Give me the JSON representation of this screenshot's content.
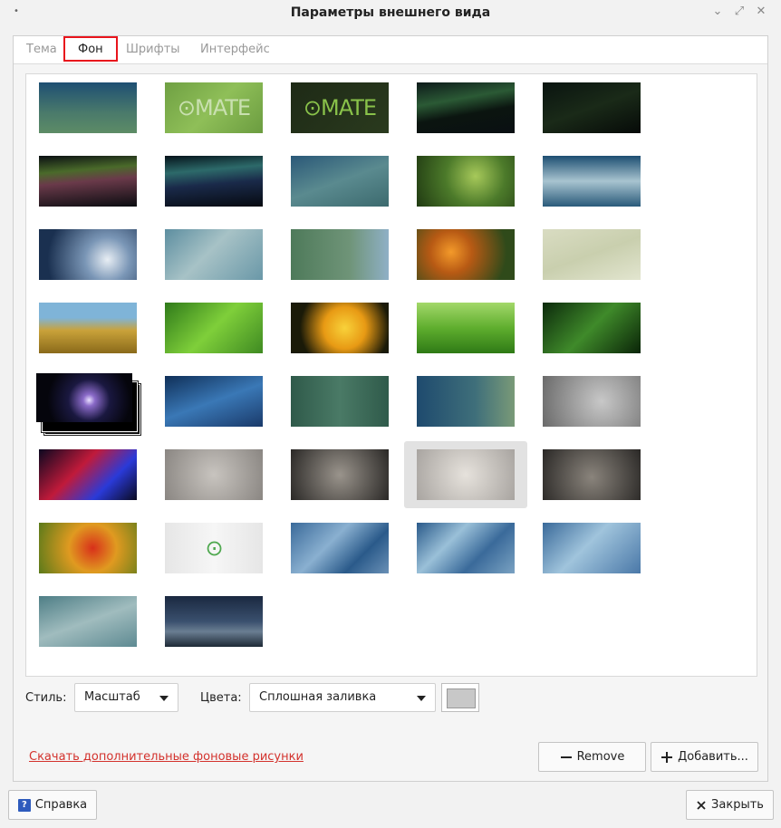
{
  "window": {
    "title": "Параметры внешнего вида",
    "menu_glyph": "•",
    "ctl_shade": "⌄",
    "ctl_maximize": "⤢",
    "ctl_close": "✕"
  },
  "tabs": [
    {
      "label": "Тема",
      "active": false
    },
    {
      "label": "Фон",
      "active": true
    },
    {
      "label": "Шрифты",
      "active": false
    },
    {
      "label": "Интерфейс",
      "active": false
    }
  ],
  "thumbnails": [
    {
      "name": "plain-blue-green",
      "bg": "linear-gradient(180deg,#1e4f73 0%,#4a7a6b 60%,#5d8c66 100%)",
      "text": ""
    },
    {
      "name": "mate-logo-green",
      "bg": "linear-gradient(135deg,#6fa043 0%,#8fbf58 50%,#6b9c40 100%)",
      "text": "⊙MATE",
      "text_color": "#c9e0b0"
    },
    {
      "name": "mate-logo-dark",
      "bg": "linear-gradient(135deg,#1e2a16 0%,#2a3a1e 100%)",
      "text": "⊙MATE",
      "text_color": "#89c24a"
    },
    {
      "name": "aurora-dark",
      "bg": "linear-gradient(170deg,#0d1a1a 0%,#2b5a35 35%,#0b1510 60%,#0a0f12 100%)",
      "text": ""
    },
    {
      "name": "dark-teal",
      "bg": "linear-gradient(160deg,#0a1410 0%,#1a2a18 50%,#060a08 100%)",
      "text": ""
    },
    {
      "name": "aurora-colorful",
      "bg": "linear-gradient(175deg,#0a0e12 0%,#4a6a2a 30%,#6a3a4a 50%,#0a0c10 100%)",
      "text": ""
    },
    {
      "name": "aurora-cyan",
      "bg": "linear-gradient(175deg,#05121a 0%,#2d6a6a 30%,#1a2a4a 55%,#060a10 100%)",
      "text": ""
    },
    {
      "name": "blue-curve",
      "bg": "linear-gradient(160deg,#2a5878 0%,#5a8a8f 50%,#3c6a6e 100%)",
      "text": ""
    },
    {
      "name": "ladybug-grass",
      "bg": "radial-gradient(circle at 60% 40%,#a7c95a 0%,#4c7a2a 45%,#203a12 100%)",
      "text": ""
    },
    {
      "name": "blue-wave",
      "bg": "linear-gradient(180deg,#1d4e72 0%,#a8c4d0 50%,#2a5a7a 100%)",
      "text": ""
    },
    {
      "name": "water-drop",
      "bg": "radial-gradient(circle at 70% 60%,#e8eef4 0%,#7a96b6 30%,#1a3050 80%)",
      "text": ""
    },
    {
      "name": "pale-curves",
      "bg": "linear-gradient(135deg,#5d8ea0 0%,#a7c2c6 45%,#6a98a8 100%)",
      "text": ""
    },
    {
      "name": "green-blue-glow",
      "bg": "linear-gradient(90deg,#4e7a5a 0%,#6f9478 60%,#8fb0c6 100%)",
      "text": ""
    },
    {
      "name": "orange-flowers",
      "bg": "radial-gradient(circle at 35% 45%,#f39a2a 0%,#b85a14 30%,#2f4a1a 80%)",
      "text": ""
    },
    {
      "name": "wood-planks",
      "bg": "linear-gradient(160deg,#d9dcc2 0%,#c9cfae 50%,#e2e5cf 100%)",
      "text": ""
    },
    {
      "name": "beach-grass",
      "bg": "linear-gradient(180deg,#7fb4d8 0%,#7fb4d8 30%,#c9a23a 55%,#8a6a1a 100%)",
      "text": ""
    },
    {
      "name": "green-leaf",
      "bg": "linear-gradient(135deg,#2f7a1a 0%,#7fcf3a 50%,#3f8a22 100%)",
      "text": ""
    },
    {
      "name": "yellow-flower",
      "bg": "radial-gradient(circle at 55% 50%,#f8d23a 0%,#e89a14 35%,#1a1a08 75%)",
      "text": ""
    },
    {
      "name": "fresh-grass",
      "bg": "linear-gradient(180deg,#a3d86a 0%,#5fae2e 50%,#2f7a16 100%)",
      "text": ""
    },
    {
      "name": "wet-leaf",
      "bg": "linear-gradient(135deg,#0c2a0c 0%,#3f8a2a 50%,#0a2408 100%)",
      "text": ""
    },
    {
      "name": "orange-petals",
      "bg": "radial-gradient(circle at 50% 55%,#ffb030 0%,#e65a14 40%,#a02a0a 100%)",
      "text": ""
    },
    {
      "name": "blue-bubbles",
      "bg": "linear-gradient(160deg,#0f2f58 0%,#3a78b6 50%,#1a3a6a 100%)",
      "text": ""
    },
    {
      "name": "green-stripes",
      "bg": "linear-gradient(90deg,#2f5a4a 0%,#4a7a66 50%,#2f5a4a 100%)",
      "text": ""
    },
    {
      "name": "blue-green-bokeh",
      "bg": "linear-gradient(90deg,#1e4a6e 0%,#3f6f7a 60%,#7a9a78 100%)",
      "text": ""
    },
    {
      "name": "red-cube",
      "bg": "radial-gradient(circle at 60% 50%,#c8c8c8 0%,#6a6a6a 100%)",
      "text": ""
    },
    {
      "name": "red-blue-abstract",
      "bg": "linear-gradient(135deg,#0b0820 0%,#c01a3a 40%,#2a3ad8 70%,#0a0a20 100%)",
      "text": ""
    },
    {
      "name": "room-gray",
      "bg": "radial-gradient(circle at 50% 50%,#c8c4bf 0%,#8a8682 100%)",
      "text": ""
    },
    {
      "name": "room-dark",
      "bg": "radial-gradient(circle at 50% 50%,#9a948c 0%,#2a2826 100%)",
      "text": ""
    },
    {
      "name": "room-light",
      "bg": "radial-gradient(circle at 50% 50%,#e6e2dc 0%,#a8a4a0 100%)",
      "text": ""
    },
    {
      "name": "room-dark-2",
      "bg": "radial-gradient(circle at 50% 55%,#8a847c 0%,#2a2826 100%)",
      "text": ""
    },
    {
      "name": "red-flower",
      "bg": "radial-gradient(circle at 55% 50%,#d8301a 0%,#e09a20 40%,#5a7a1a 100%)",
      "text": ""
    },
    {
      "name": "mate-logo-white",
      "bg": "linear-gradient(90deg,#e6e6e6 0%,#f6f6f6 50%,#e6e6e6 100%)",
      "text": "⊙",
      "text_color": "#4fa84f"
    },
    {
      "name": "blue-paint",
      "bg": "linear-gradient(135deg,#3a6a9a 0%,#8ab0d0 40%,#2a5a8a 70%,#6a90b6 100%)",
      "text": ""
    },
    {
      "name": "blue-paint-2",
      "bg": "linear-gradient(135deg,#2a5a8a 0%,#9ac0d8 35%,#3a6a9a 65%,#7aa2c2 100%)",
      "text": ""
    },
    {
      "name": "blue-paint-3",
      "bg": "linear-gradient(135deg,#3a6a9a 0%,#a0c4dc 45%,#4a78a8 100%)",
      "text": ""
    },
    {
      "name": "teal-curves",
      "bg": "linear-gradient(160deg,#4e7e86 0%,#a0bcbe 50%,#5e8a92 100%)",
      "text": ""
    },
    {
      "name": "stormy-sea",
      "bg": "linear-gradient(180deg,#1a2840 0%,#3a506e 50%,#6a7e92 70%,#1e2a36 100%)",
      "text": ""
    }
  ],
  "controls": {
    "style_label": "Стиль:",
    "style_value": "Масштаб",
    "colors_label": "Цвета:",
    "colors_value": "Сплошная заливка",
    "color_swatch": "#c8c8c8",
    "download_link": "Скачать дополнительные фоновые рисунки",
    "remove_label": "Remove",
    "add_label": "Добавить..."
  },
  "footer": {
    "help_label": "Справка",
    "help_glyph": "?",
    "close_label": "Закрыть"
  }
}
